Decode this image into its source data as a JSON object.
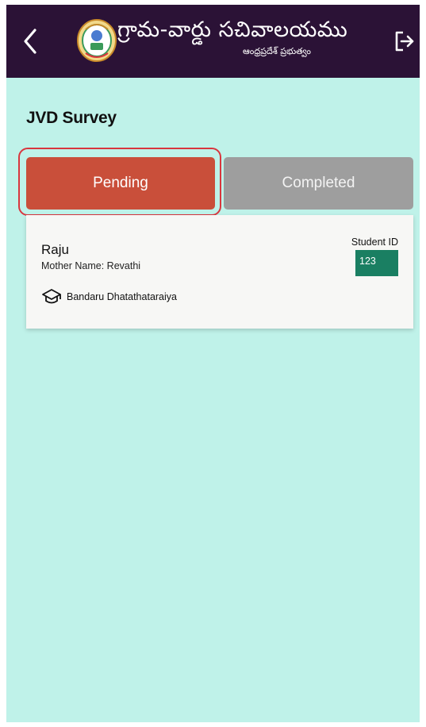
{
  "header": {
    "brand_title": "గ్రామ-వార్డు సచివాలయము",
    "brand_subtitle": "ఆంధ్రప్రదేశ్ ప్రభుత్వం",
    "colors": {
      "appbar": "#2b1236",
      "background": "#bff2e9"
    },
    "icons": {
      "back": "chevron-left-icon",
      "logout": "logout-icon",
      "logo": "emblem-logo"
    }
  },
  "page": {
    "title": "JVD Survey"
  },
  "tabs": [
    {
      "label": "Pending",
      "selected": true,
      "color": "#c94f3a"
    },
    {
      "label": "Completed",
      "selected": false,
      "color": "#9e9e9e"
    }
  ],
  "students": [
    {
      "name": "Raju",
      "mother": "Mother Name: Revathi",
      "school": "Bandaru Dhatathataraiya",
      "student_id_label": "Student ID",
      "student_id": "123"
    }
  ]
}
